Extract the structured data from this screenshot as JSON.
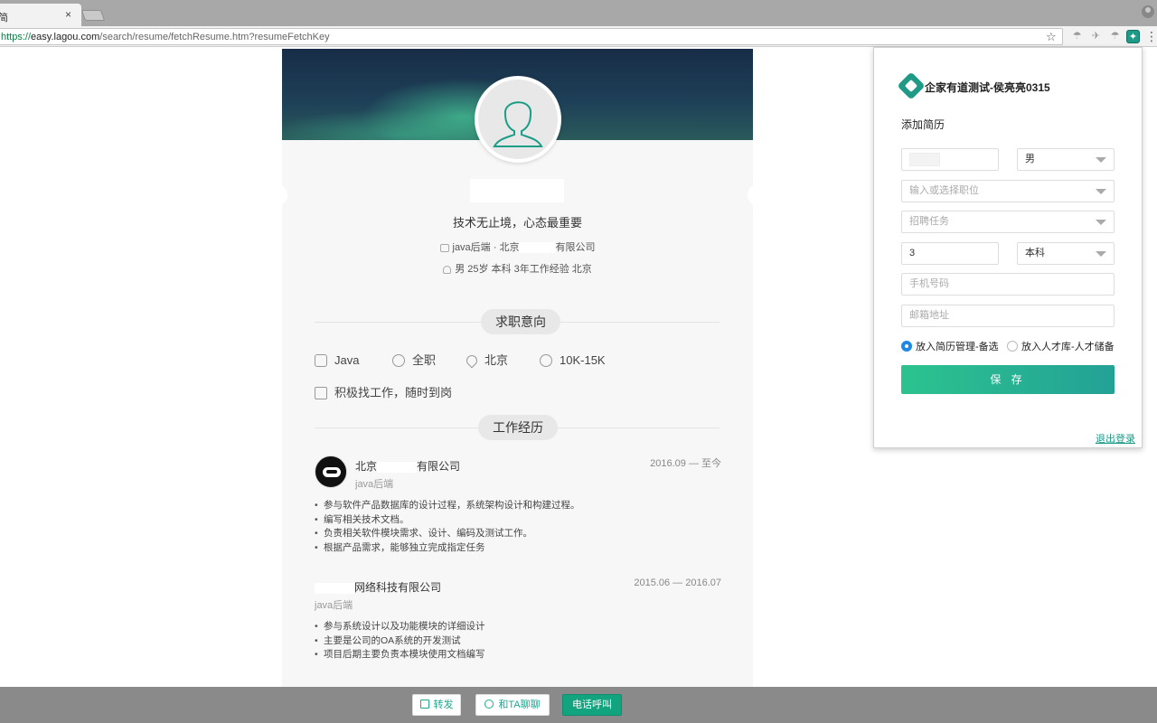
{
  "browser": {
    "tab_title": "简",
    "tab_close": "×",
    "url_proto": "https://",
    "url_host": "easy.lagou.com",
    "url_path": "/search/resume/fetchResume.htm?resumeFetchKey",
    "star": "☆",
    "menu": "⋮"
  },
  "resume": {
    "motto": "技术无止境，心态最重要",
    "meta_role": "java后端",
    "meta_sep": "·",
    "meta_city": "北京",
    "meta_company_suffix": "有限公司",
    "meta_profile": "男 25岁 本科 3年工作经验 北京",
    "intent_heading": "求职意向",
    "intent": {
      "position": "Java",
      "type": "全职",
      "city": "北京",
      "salary": "10K-15K",
      "status": "积极找工作，随时到岗"
    },
    "work_heading": "工作经历",
    "jobs": [
      {
        "company_prefix": "北京",
        "company_suffix": "有限公司",
        "role": "java后端",
        "date": "2016.09 — 至今",
        "duties": [
          "参与软件产品数据库的设计过程，系统架构设计和构建过程。",
          "编写相关技术文档。",
          "负责相关软件模块需求、设计、编码及测试工作。",
          "根据产品需求，能够独立完成指定任务"
        ]
      },
      {
        "company_suffix": "网络科技有限公司",
        "role": "java后端",
        "date": "2015.06 — 2016.07",
        "duties": [
          "参与系统设计以及功能模块的详细设计",
          "主要是公司的OA系统的开发测试",
          "项目后期主要负责本模块使用文档编写"
        ]
      }
    ]
  },
  "actions": {
    "forward": "转发",
    "chat": "和TA聊聊",
    "call": "电话呼叫"
  },
  "popup": {
    "title": "企家有道测试-侯亮亮0315",
    "heading": "添加简历",
    "gender": "男",
    "position_placeholder": "输入或选择职位",
    "task_placeholder": "招聘任务",
    "years": "3",
    "education": "本科",
    "phone_placeholder": "手机号码",
    "email_placeholder": "邮箱地址",
    "radio_manage": "放入简历管理-备选",
    "radio_pool": "放入人才库-人才储备",
    "save": "保 存",
    "logout": "退出登录"
  },
  "colors": {
    "brand_green": "#1f9a86",
    "save_gradient_start": "#2cc38f",
    "save_gradient_end": "#23a196",
    "radio_active": "#1e88e5",
    "call_button": "#12a37f"
  },
  "icons": [
    "briefcase-icon",
    "clock-icon",
    "location-icon",
    "salary-icon",
    "status-icon",
    "share-icon",
    "chat-icon",
    "star-icon",
    "profile-icon",
    "extension-icon"
  ]
}
